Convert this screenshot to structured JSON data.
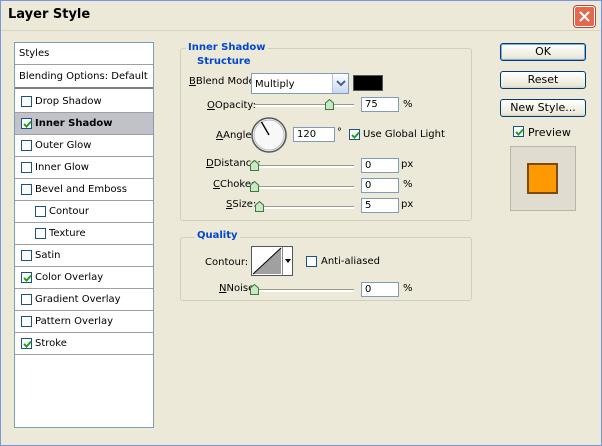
{
  "window": {
    "title": "Layer Style"
  },
  "styles_list": {
    "header": "Styles",
    "blending": "Blending Options: Default",
    "items": [
      {
        "label": "Drop Shadow",
        "checked": false,
        "selected": false,
        "indent": false
      },
      {
        "label": "Inner Shadow",
        "checked": true,
        "selected": true,
        "indent": false
      },
      {
        "label": "Outer Glow",
        "checked": false,
        "selected": false,
        "indent": false
      },
      {
        "label": "Inner Glow",
        "checked": false,
        "selected": false,
        "indent": false
      },
      {
        "label": "Bevel and Emboss",
        "checked": false,
        "selected": false,
        "indent": false
      },
      {
        "label": "Contour",
        "checked": false,
        "selected": false,
        "indent": true
      },
      {
        "label": "Texture",
        "checked": false,
        "selected": false,
        "indent": true
      },
      {
        "label": "Satin",
        "checked": false,
        "selected": false,
        "indent": false
      },
      {
        "label": "Color Overlay",
        "checked": true,
        "selected": false,
        "indent": false
      },
      {
        "label": "Gradient Overlay",
        "checked": false,
        "selected": false,
        "indent": false
      },
      {
        "label": "Pattern Overlay",
        "checked": false,
        "selected": false,
        "indent": false
      },
      {
        "label": "Stroke",
        "checked": true,
        "selected": false,
        "indent": false
      }
    ]
  },
  "inner_shadow": {
    "title": "Inner Shadow",
    "structure": {
      "title": "Structure",
      "blend_mode_label": "Blend Mode:",
      "blend_mode_value": "Multiply",
      "blend_color": "#000000",
      "opacity_label": "Opacity:",
      "opacity_value": "75",
      "opacity_unit": "%",
      "opacity_fraction": 0.75,
      "angle_label": "Angle:",
      "angle_value": "120",
      "angle_unit": "°",
      "global_light_label": "Use Global Light",
      "global_light_checked": true,
      "distance_label": "Distance:",
      "distance_value": "0",
      "distance_unit": "px",
      "choke_label": "Choke:",
      "choke_value": "0",
      "choke_unit": "%",
      "size_label": "Size:",
      "size_value": "5",
      "size_unit": "px"
    },
    "quality": {
      "title": "Quality",
      "contour_label": "Contour:",
      "antialiased_label": "Anti-aliased",
      "antialiased_checked": false,
      "noise_label": "Noise:",
      "noise_value": "0",
      "noise_unit": "%"
    }
  },
  "buttons": {
    "ok": "OK",
    "reset": "Reset",
    "new_style": "New Style..."
  },
  "preview": {
    "label": "Preview",
    "checked": true,
    "swatch_color": "#ff9900"
  },
  "colors": {
    "accent": "#0046d5",
    "selection": "#c1c1c9",
    "dialog_bg": "#ece9d8"
  }
}
